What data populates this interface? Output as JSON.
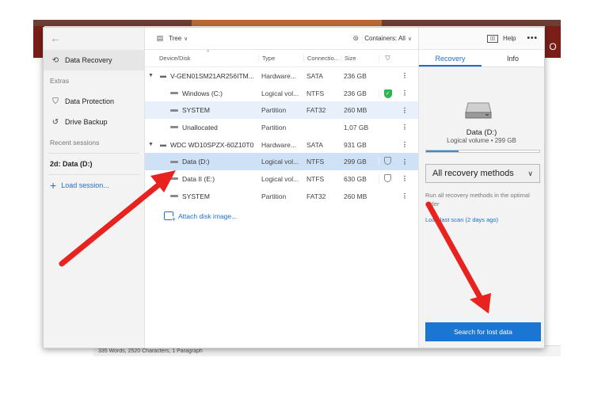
{
  "background": {
    "right_badge": "O",
    "status_bar": "335 Words, 2520 Characters, 1 Paragraph"
  },
  "sidebar": {
    "back_icon": "back-arrow-icon",
    "items": [
      {
        "label": "Data Recovery",
        "icon": "recovery-icon",
        "active": true
      }
    ],
    "extras_label": "Extras",
    "extras": [
      {
        "label": "Data Protection",
        "icon": "shield-icon"
      },
      {
        "label": "Drive Backup",
        "icon": "backup-icon"
      }
    ],
    "recent_label": "Recent sessions",
    "session": "2d: Data (D:)",
    "load_session": "Load session..."
  },
  "toolbar": {
    "view_label": "Tree",
    "filter_label": "Containers: All",
    "help_label": "Help"
  },
  "table": {
    "headers": {
      "name": "Device/Disk",
      "type": "Type",
      "connection": "Connectio...",
      "size": "Size"
    },
    "rows": [
      {
        "name": "V-GEN01SM21AR256ITM...",
        "type": "Hardware...",
        "connection": "SATA",
        "size": "236 GB",
        "level": 0,
        "protection": ""
      },
      {
        "name": "Windows (C:)",
        "type": "Logical vol...",
        "connection": "NTFS",
        "size": "236 GB",
        "level": 1,
        "protection": "on"
      },
      {
        "name": "SYSTEM",
        "type": "Partition",
        "connection": "FAT32",
        "size": "260 MB",
        "level": 1,
        "protection": ""
      },
      {
        "name": "Unallocated",
        "type": "Partition",
        "connection": "",
        "size": "1,07 GB",
        "level": 1,
        "protection": ""
      },
      {
        "name": "WDC WD10SPZX-60Z10T0",
        "type": "Hardware...",
        "connection": "SATA",
        "size": "931 GB",
        "level": 0,
        "protection": ""
      },
      {
        "name": "Data (D:)",
        "type": "Logical vol...",
        "connection": "NTFS",
        "size": "299 GB",
        "level": 1,
        "protection": "off"
      },
      {
        "name": "Data II (E:)",
        "type": "Logical vol...",
        "connection": "NTFS",
        "size": "630 GB",
        "level": 1,
        "protection": "off"
      },
      {
        "name": "SYSTEM",
        "type": "Partition",
        "connection": "FAT32",
        "size": "260 MB",
        "level": 1,
        "protection": ""
      }
    ],
    "attach_label": "Attach disk image..."
  },
  "right_panel": {
    "tabs": [
      "Recovery",
      "Info"
    ],
    "drive_name": "Data (D:)",
    "drive_info": "Logical volume • 299 GB",
    "usage_fraction": 0.29,
    "method_label": "All recovery methods",
    "method_description": "Run all recovery methods in the optimal order",
    "last_scan": "Load last scan (2 days ago)",
    "search_button": "Search for lost data"
  },
  "colors": {
    "accent": "#1a76d2",
    "selection": "#cfe1f7",
    "arrow": "#e8231f",
    "protect_ok": "#2db552"
  }
}
